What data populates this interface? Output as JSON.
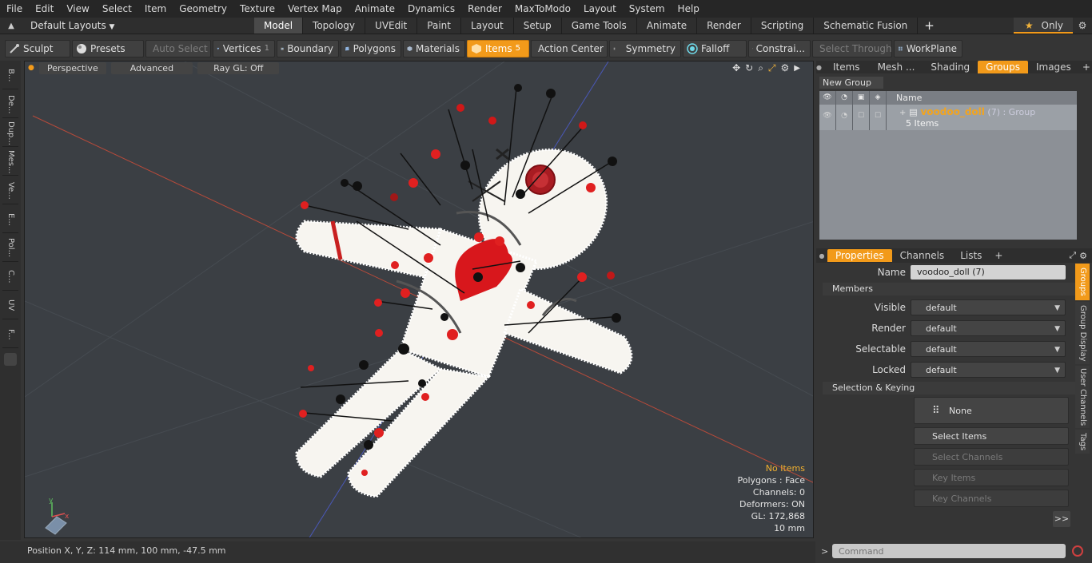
{
  "menubar": [
    "File",
    "Edit",
    "View",
    "Select",
    "Item",
    "Geometry",
    "Texture",
    "Vertex Map",
    "Animate",
    "Dynamics",
    "Render",
    "MaxToModo",
    "Layout",
    "System",
    "Help"
  ],
  "layout": {
    "preset": "Default Layouts",
    "tabs": [
      "Model",
      "Topology",
      "UVEdit",
      "Paint",
      "Layout",
      "Setup",
      "Game Tools",
      "Animate",
      "Render",
      "Scripting",
      "Schematic Fusion"
    ],
    "active_tab": "Model",
    "only_label": "Only"
  },
  "toolbar": {
    "sculpt": "Sculpt",
    "presets": "Presets",
    "auto_select": "Auto Select",
    "vertices": "Vertices",
    "vertices_count": "1",
    "boundary": "Boundary",
    "polygons": "Polygons",
    "materials": "Materials",
    "items": "Items",
    "items_count": "5",
    "action_center": "Action Center",
    "symmetry": "Symmetry",
    "falloff": "Falloff",
    "constraints": "Constrai...",
    "select_through": "Select Through",
    "workplane": "WorkPlane"
  },
  "left_tabs": [
    "B...",
    "De...",
    "Dup...",
    "Mes...",
    "Ve...",
    "E...",
    "Pol...",
    "C...",
    "UV",
    "F..."
  ],
  "viewport": {
    "view": "Perspective",
    "shading": "Advanced",
    "raygl": "Ray GL: Off",
    "info": {
      "selection": "No Items",
      "polygons": "Polygons : Face",
      "channels": "Channels: 0",
      "deformers": "Deformers: ON",
      "gl": "GL: 172,868",
      "scale": "10 mm"
    }
  },
  "status": {
    "position": "Position X, Y, Z:   114 mm, 100 mm, -47.5 mm"
  },
  "top_panel": {
    "tabs": [
      "Items",
      "Mesh ...",
      "Shading",
      "Groups",
      "Images"
    ],
    "active": "Groups",
    "new_group": "New Group",
    "name_header": "Name",
    "group": {
      "name": "voodoo_doll",
      "suffix": " (7) : Group",
      "count": "5 Items"
    }
  },
  "props_panel": {
    "tabs": [
      "Properties",
      "Channels",
      "Lists"
    ],
    "active": "Properties",
    "name_label": "Name",
    "name_value": "voodoo_doll (7)",
    "members_header": "Members",
    "visible_label": "Visible",
    "render_label": "Render",
    "selectable_label": "Selectable",
    "locked_label": "Locked",
    "default_value": "default",
    "selection_header": "Selection & Keying",
    "none_label": "None",
    "select_items": "Select Items",
    "select_channels": "Select Channels",
    "key_items": "Key Items",
    "key_channels": "Key Channels",
    "more": ">>",
    "side_tabs": [
      "Groups",
      "Group Display",
      "User Channels",
      "Tags"
    ]
  },
  "command": {
    "placeholder": "Command"
  }
}
